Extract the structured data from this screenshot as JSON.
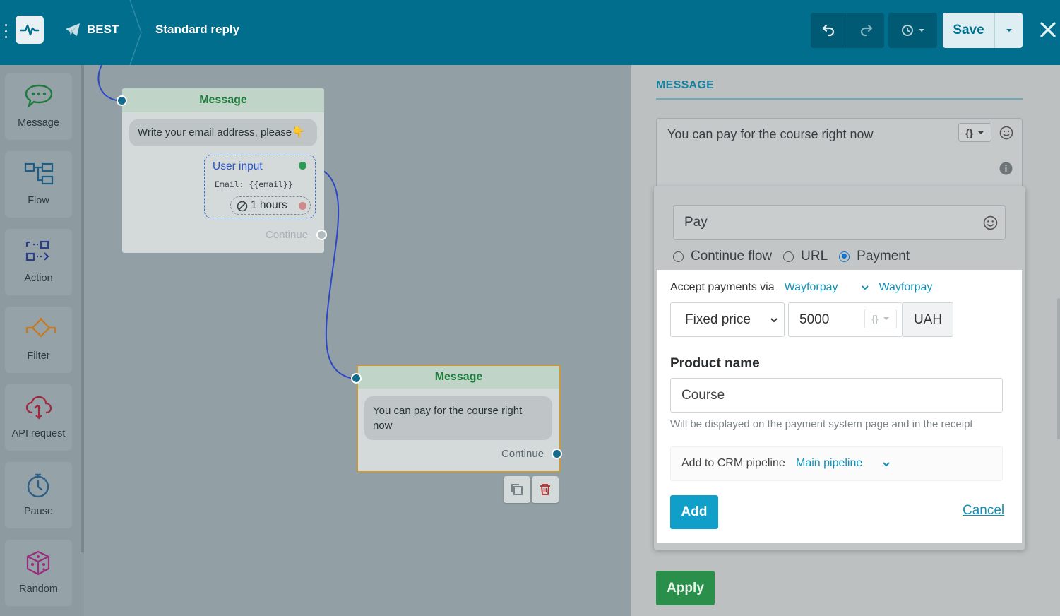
{
  "header": {
    "bot_name": "BEST",
    "page_title": "Standard reply",
    "save_label": "Save"
  },
  "sidebar": {
    "items": [
      {
        "label": "Message",
        "icon": "chat-bubble-icon"
      },
      {
        "label": "Flow",
        "icon": "flow-icon"
      },
      {
        "label": "Action",
        "icon": "action-icon"
      },
      {
        "label": "Filter",
        "icon": "filter-icon"
      },
      {
        "label": "API request",
        "icon": "cloud-api-icon"
      },
      {
        "label": "Pause",
        "icon": "stopwatch-icon"
      },
      {
        "label": "Random",
        "icon": "dice-icon"
      }
    ]
  },
  "canvas": {
    "node1": {
      "title": "Message",
      "text": "Write your email address, please",
      "emoji": "👇",
      "user_input_label": "User input",
      "user_input_var": "Email: {{email}}",
      "timeout": "1 hours",
      "continue": "Continue"
    },
    "node2": {
      "title": "Message",
      "text_line1": "You can pay for the course right",
      "text_line2": "now",
      "continue": "Continue"
    }
  },
  "panel": {
    "title": "MESSAGE",
    "message_text": "You can pay for the course right now",
    "var_button": "{}",
    "button_text": "Pay",
    "radio_options": [
      "Continue flow",
      "URL",
      "Payment"
    ],
    "selected_radio": "Payment",
    "accept_label": "Accept payments via",
    "provider_selected": "Wayforpay",
    "provider_link": "Wayforpay",
    "price_type": "Fixed price",
    "amount": "5000",
    "currency": "UAH",
    "product_label": "Product name",
    "product_value": "Course",
    "product_hint": "Will be displayed on the payment system page and in the receipt",
    "crm_label": "Add to CRM pipeline",
    "crm_value": "Main pipeline",
    "add_label": "Add",
    "cancel_label": "Cancel",
    "apply_label": "Apply"
  },
  "colors": {
    "topbar": "#006e8c",
    "accent": "#0f9fc8",
    "apply": "#2a8f4a",
    "link": "#1590b5"
  }
}
